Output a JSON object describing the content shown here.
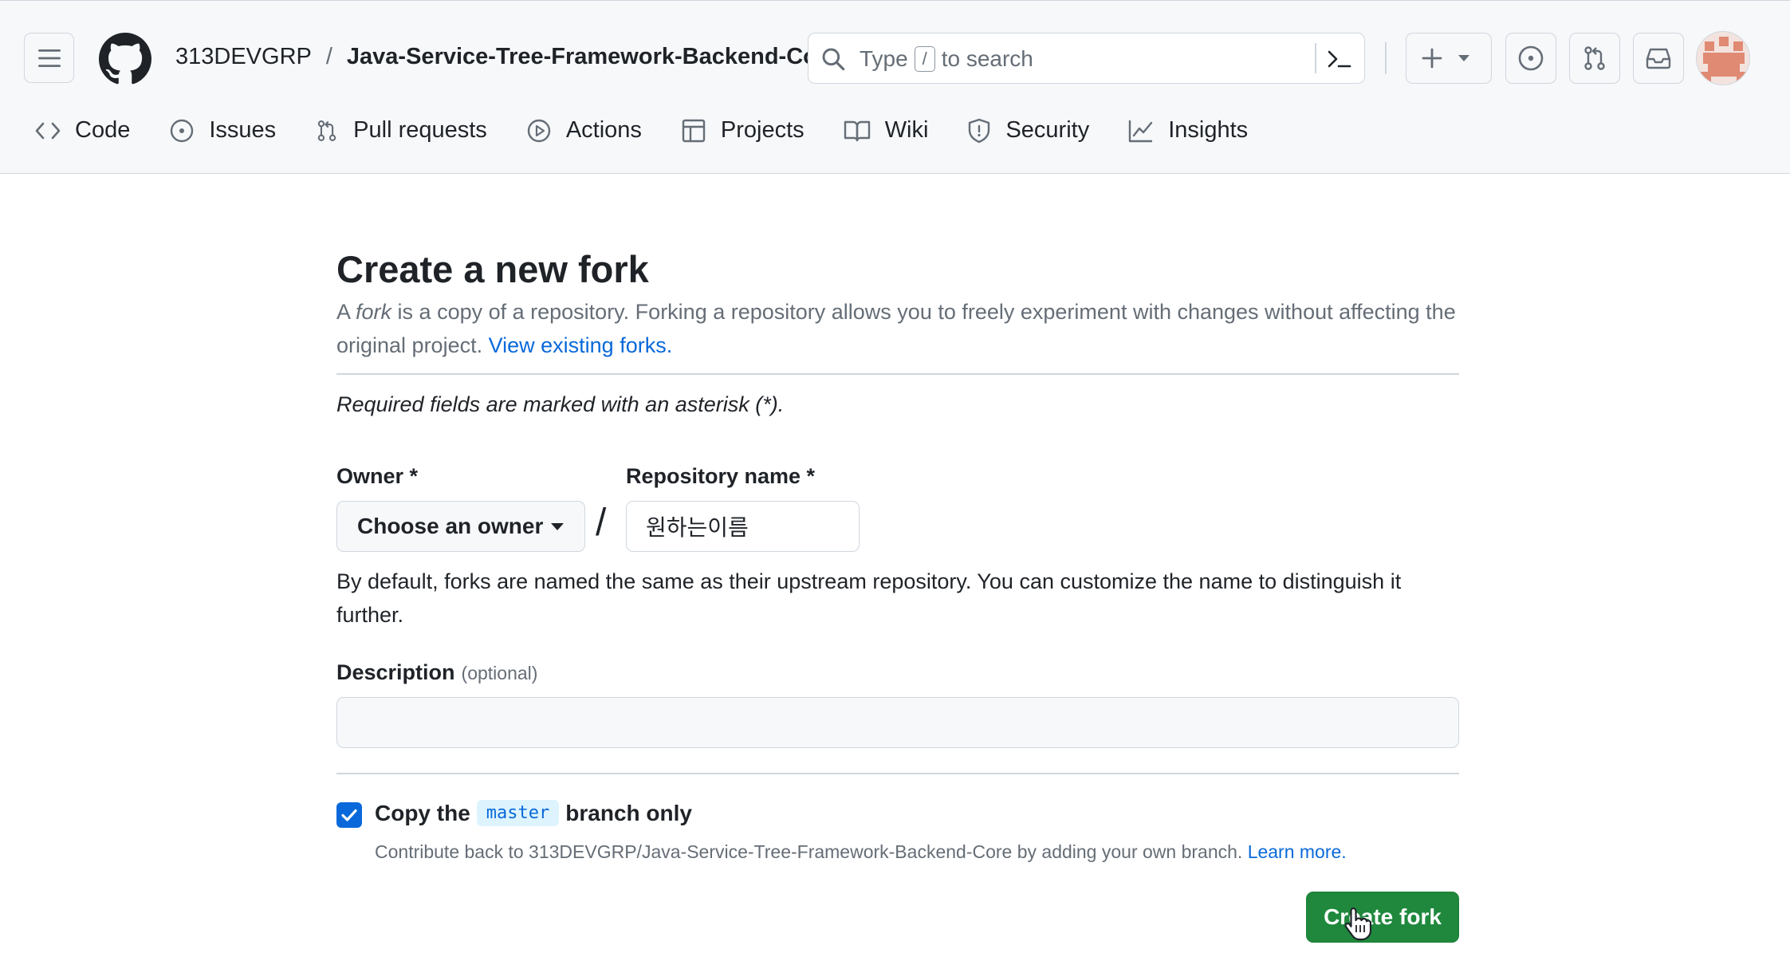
{
  "header": {
    "breadcrumb": {
      "owner": "313DEVGRP",
      "separator": "/",
      "repo": "Java-Service-Tree-Framework-Backend-Core"
    },
    "search": {
      "prefix": "Type",
      "key": "/",
      "suffix": "to search"
    }
  },
  "tabs": [
    {
      "label": "Code",
      "icon": "code-icon"
    },
    {
      "label": "Issues",
      "icon": "issue-opened-icon"
    },
    {
      "label": "Pull requests",
      "icon": "git-pull-request-icon"
    },
    {
      "label": "Actions",
      "icon": "play-icon"
    },
    {
      "label": "Projects",
      "icon": "table-icon"
    },
    {
      "label": "Wiki",
      "icon": "book-icon"
    },
    {
      "label": "Security",
      "icon": "shield-icon"
    },
    {
      "label": "Insights",
      "icon": "graph-icon"
    }
  ],
  "form": {
    "title": "Create a new fork",
    "lead_a": "A ",
    "lead_fork": "fork",
    "lead_b": " is a copy of a repository. Forking a repository allows you to freely experiment with changes without affecting the original project. ",
    "lead_link": "View existing forks.",
    "required_note": "Required fields are marked with an asterisk (*).",
    "owner_label": "Owner *",
    "owner_value": "Choose an owner",
    "slash": "/",
    "repo_label": "Repository name *",
    "repo_value": "원하는이름",
    "name_help": "By default, forks are named the same as their upstream repository. You can customize the name to distinguish it further.",
    "description_label": "Description",
    "description_optional": "(optional)",
    "description_value": "",
    "copy_prefix": "Copy the",
    "copy_branch": "master",
    "copy_suffix": "branch only",
    "copy_checked": true,
    "contrib_text": "Contribute back to 313DEVGRP/Java-Service-Tree-Framework-Backend-Core by adding your own branch. ",
    "contrib_link": "Learn more.",
    "submit_label": "Create fork"
  },
  "colors": {
    "accent": "#0969da",
    "primary_button": "#1f883d",
    "border": "#d0d7de",
    "muted_text": "#656d76"
  }
}
